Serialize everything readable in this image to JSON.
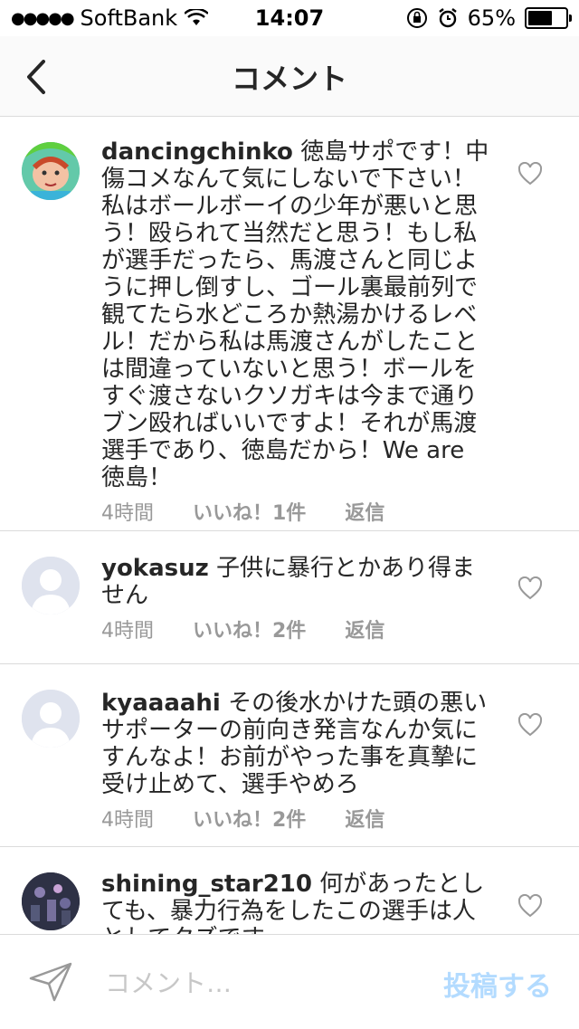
{
  "status_bar": {
    "carrier": "SoftBank",
    "time": "14:07",
    "battery_percent": "65%",
    "battery_level": 0.65,
    "icons": [
      "signal-dots-icon",
      "wifi-icon",
      "orientation-lock-icon",
      "alarm-icon",
      "battery-icon"
    ]
  },
  "nav": {
    "title": "コメント",
    "back_icon": "chevron-left-icon"
  },
  "comments": [
    {
      "username": "dancingchinko",
      "text": "徳島サポです！中傷コメなんて気にしないで下さい！私はボールボーイの少年が悪いと思う！殴られて当然だと思う！もし私が選手だったら、馬渡さんと同じように押し倒すし、ゴール裏最前列で観てたら水どころか熱湯かけるレベル！だから私は馬渡さんがしたことは間違っていないと思う！ボールをすぐ渡さないクソガキは今まで通りブン殴ればいいですよ！それが馬渡選手であり、徳島だから！We are 徳島！",
      "time": "4時間",
      "likes": "いいね！1件",
      "reply": "返信",
      "avatar": "cartoon"
    },
    {
      "username": "yokasuz",
      "text": "子供に暴行とかあり得ません",
      "time": "4時間",
      "likes": "いいね！2件",
      "reply": "返信",
      "avatar": "default"
    },
    {
      "username": "kyaaaahi",
      "text": "その後水かけた頭の悪いサポーターの前向き発言なんか気にすんなよ！お前がやった事を真摯に受け止めて、選手やめろ",
      "time": "4時間",
      "likes": "いいね！2件",
      "reply": "返信",
      "avatar": "default"
    },
    {
      "username": "shining_star210",
      "text": "何があったとしても、暴力行為をしたこの選手は人としてクズです",
      "time": "",
      "likes": "",
      "reply": "",
      "avatar": "photo"
    }
  ],
  "composer": {
    "placeholder": "コメント…",
    "post_label": "投稿する",
    "post_color": "#b3dbff"
  },
  "colors": {
    "text": "#262626",
    "meta": "#999999",
    "divider": "#dbdbdb"
  }
}
